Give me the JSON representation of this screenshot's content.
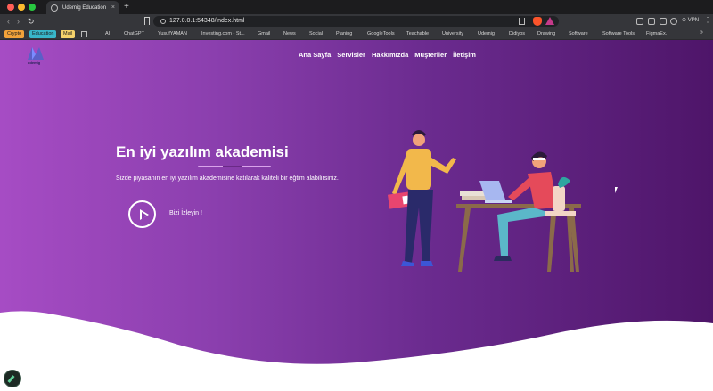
{
  "browser": {
    "tab_title": "Udemig Education",
    "tab_close": "×",
    "new_tab": "+",
    "url": "127.0.0.1:54348/index.html",
    "vpn_label": "VPN",
    "more_menu": "⋮",
    "bookmarks_more": "»",
    "bookmarks": [
      {
        "label": "Crypto",
        "color": "#f2a23a"
      },
      {
        "label": "Education",
        "color": "#38b6c9"
      },
      {
        "label": "Mail",
        "color": "#f4d26b"
      },
      {
        "label": "AI"
      },
      {
        "label": "ChatGPT"
      },
      {
        "label": "YusufYAMAN"
      },
      {
        "label": "Investing.com - St..."
      },
      {
        "label": "Gmail"
      },
      {
        "label": "News"
      },
      {
        "label": "Social"
      },
      {
        "label": "Planing"
      },
      {
        "label": "GoogleTools"
      },
      {
        "label": "Teachable"
      },
      {
        "label": "University"
      },
      {
        "label": "Udemig"
      },
      {
        "label": "Didiyos"
      },
      {
        "label": "Drawing"
      },
      {
        "label": "Software"
      },
      {
        "label": "Software Tools"
      },
      {
        "label": "FigmaEx."
      }
    ]
  },
  "page": {
    "logo_text": "udemig",
    "nav": [
      "Ana Sayfa",
      "Servisler",
      "Hakkımızda",
      "Müşteriler",
      "İletişim"
    ],
    "hero_title": "En iyi yazılım akademisi",
    "hero_subtitle": "Sizde piyasanın en iyi yazılım akademisine katılarak kaliteli bir eğtim alabilirsiniz.",
    "watch_label": "Bizi İzleyin !",
    "colors": {
      "gradient_start": "#a64cc4",
      "gradient_end": "#4e1569",
      "wave": "#ffffff"
    }
  }
}
